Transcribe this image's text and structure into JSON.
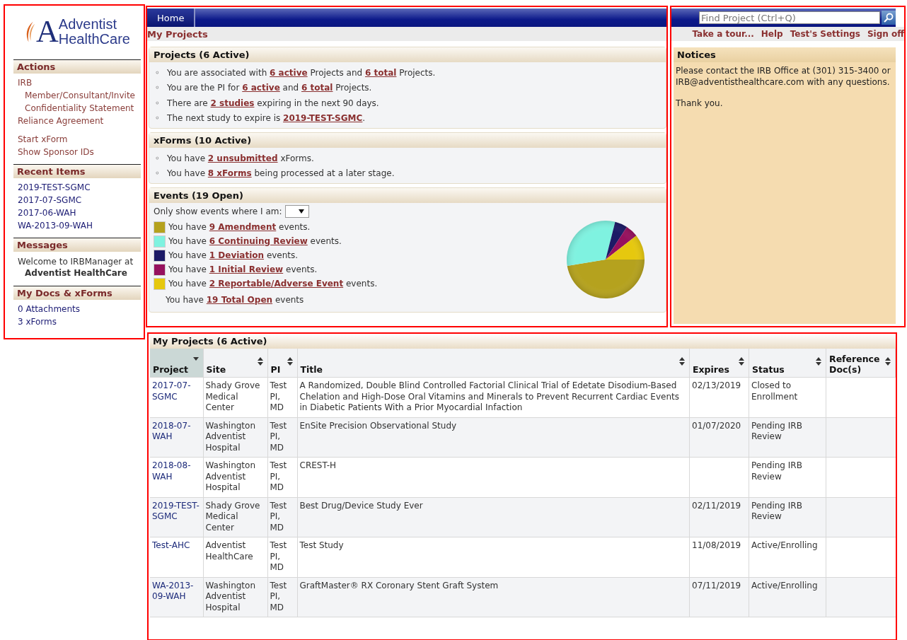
{
  "logo": {
    "mark": "A",
    "line1": "Adventist",
    "line2": "HealthCare"
  },
  "sidebar": [
    {
      "title": "Actions",
      "kind": "actions",
      "groups": [
        [
          {
            "text": "IRB",
            "children": [
              {
                "text": "Member/Consultant/Invite"
              },
              {
                "text": "Confidentiality Statement"
              }
            ]
          },
          {
            "text": "Reliance Agreement"
          }
        ],
        [
          {
            "text": "Start xForm"
          },
          {
            "text": "Show Sponsor IDs"
          }
        ]
      ]
    },
    {
      "title": "Recent Items",
      "kind": "links",
      "items": [
        {
          "text": "2019-TEST-SGMC"
        },
        {
          "text": "2017-07-SGMC"
        },
        {
          "text": "2017-06-WAH"
        },
        {
          "text": "WA-2013-09-WAH"
        }
      ]
    },
    {
      "title": "Messages",
      "kind": "message",
      "items": [
        {
          "text": "Welcome to IRBManager at **Adventist HealthCare**"
        }
      ]
    },
    {
      "title": "My Docs & xForms",
      "kind": "links",
      "items": [
        {
          "text": "0 Attachments"
        },
        {
          "text": "3 xForms"
        }
      ]
    }
  ],
  "tabs": [
    {
      "label": "Home",
      "selected": true
    }
  ],
  "search": {
    "placeholder": "Find Project (Ctrl+Q)"
  },
  "breadcrumb": "My Projects",
  "top_links": [
    "Take a tour...",
    "Help",
    "Test's Settings",
    "Sign off"
  ],
  "projects_panel": {
    "title": "Projects (6 Active)",
    "bullet": "◦",
    "lines": [
      [
        {
          "kind": "text",
          "text": "You are associated with "
        },
        {
          "kind": "link",
          "text": "6 active"
        },
        {
          "kind": "text",
          "text": " Projects and "
        },
        {
          "kind": "link",
          "text": "6 total"
        },
        {
          "kind": "text",
          "text": " Projects."
        }
      ],
      [
        {
          "kind": "text",
          "text": "You are the PI for "
        },
        {
          "kind": "link",
          "text": "6 active"
        },
        {
          "kind": "text",
          "text": " and "
        },
        {
          "kind": "link",
          "text": "6 total"
        },
        {
          "kind": "text",
          "text": " Projects."
        }
      ],
      [
        {
          "kind": "text",
          "text": "There are "
        },
        {
          "kind": "link",
          "text": "2 studies"
        },
        {
          "kind": "text",
          "text": " expiring in the next 90 days."
        }
      ],
      [
        {
          "kind": "text",
          "text": "The next study to expire is "
        },
        {
          "kind": "link",
          "text": "2019-TEST-SGMC"
        },
        {
          "kind": "text",
          "text": "."
        }
      ]
    ]
  },
  "xforms_panel": {
    "title": "xForms (10 Active)",
    "bullet": "◦",
    "lines": [
      [
        {
          "kind": "text",
          "text": "You have "
        },
        {
          "kind": "link",
          "text": "2 unsubmitted"
        },
        {
          "kind": "text",
          "text": " xForms."
        }
      ],
      [
        {
          "kind": "text",
          "text": "You have "
        },
        {
          "kind": "link",
          "text": "8 xForms"
        },
        {
          "kind": "text",
          "text": " being processed at a later stage."
        }
      ]
    ]
  },
  "events_panel": {
    "title": "Events (19 Open)",
    "filter_label": "Only show events where I am:",
    "items": [
      {
        "prefix": "You have ",
        "link": "9 Amendment",
        "suffix": " events.",
        "color": "#b5a21e"
      },
      {
        "prefix": "You have ",
        "link": "6 Continuing Review",
        "suffix": " events.",
        "color": "#7ff2e0"
      },
      {
        "prefix": "You have ",
        "link": "1 Deviation",
        "suffix": " events.",
        "color": "#1c1a66"
      },
      {
        "prefix": "You have ",
        "link": "1 Initial Review",
        "suffix": " events.",
        "color": "#96115e"
      },
      {
        "prefix": "You have ",
        "link": "2 Reportable/Adverse Event",
        "suffix": " events.",
        "color": "#e6c80e"
      }
    ],
    "total": {
      "prefix": "You have ",
      "link": "19 Total Open",
      "suffix": " events"
    },
    "chart_data": {
      "type": "pie",
      "values": [
        47.37,
        31.58,
        5.26,
        5.26,
        10.53
      ]
    }
  },
  "notices": {
    "title": "Notices",
    "paragraphs": [
      "Please contact the IRB Office at (301) 315-3400 or IRB@adventisthealthcare.com with any questions.",
      "Thank you."
    ]
  },
  "table": {
    "title": "My Projects (6 Active)",
    "columns": [
      {
        "label": "Project",
        "sorted": true
      },
      {
        "label": "Site",
        "sorted": false
      },
      {
        "label": "PI",
        "sorted": false
      },
      {
        "label": "Title",
        "sorted": false
      },
      {
        "label": "Expires",
        "sorted": false
      },
      {
        "label": "Status",
        "sorted": false
      },
      {
        "label": "Reference Doc(s)",
        "sorted": false
      }
    ],
    "rows": [
      {
        "project": "2017-07-SGMC",
        "site": "Shady Grove Medical Center",
        "pi": "Test PI, MD",
        "title": "A Randomized, Double Blind Controlled Factorial Clinical Trial of Edetate Disodium-Based Chelation and High-Dose Oral Vitamins and Minerals to Prevent Recurrent Cardiac Events in Diabetic Patients With a Prior Myocardial Infaction",
        "expires": "02/13/2019",
        "status": "Closed to Enrollment"
      },
      {
        "project": "2018-07-WAH",
        "site": "Washington Adventist Hospital",
        "pi": "Test PI, MD",
        "title": "EnSite Precision Observational Study",
        "expires": "01/07/2020",
        "status": "Pending IRB Review"
      },
      {
        "project": "2018-08-WAH",
        "site": "Washington Adventist Hospital",
        "pi": "Test PI, MD",
        "title": "CREST-H",
        "status": "Pending IRB Review"
      },
      {
        "project": "2019-TEST-SGMC",
        "site": "Shady Grove Medical Center",
        "pi": "Test PI, MD",
        "title": "Best Drug/Device Study Ever",
        "expires": "02/11/2019",
        "status": "Pending IRB Review"
      },
      {
        "project": "Test-AHC",
        "site": "Adventist HealthCare",
        "pi": "Test PI, MD",
        "title": "Test Study",
        "expires": "11/08/2019",
        "status": "Active/Enrolling"
      },
      {
        "project": "WA-2013-09-WAH",
        "site": "Washington Adventist Hospital",
        "pi": "Test PI, MD",
        "title": "GraftMaster® RX Coronary Stent Graft System",
        "expires": "07/11/2019",
        "status": "Active/Enrolling"
      }
    ]
  }
}
